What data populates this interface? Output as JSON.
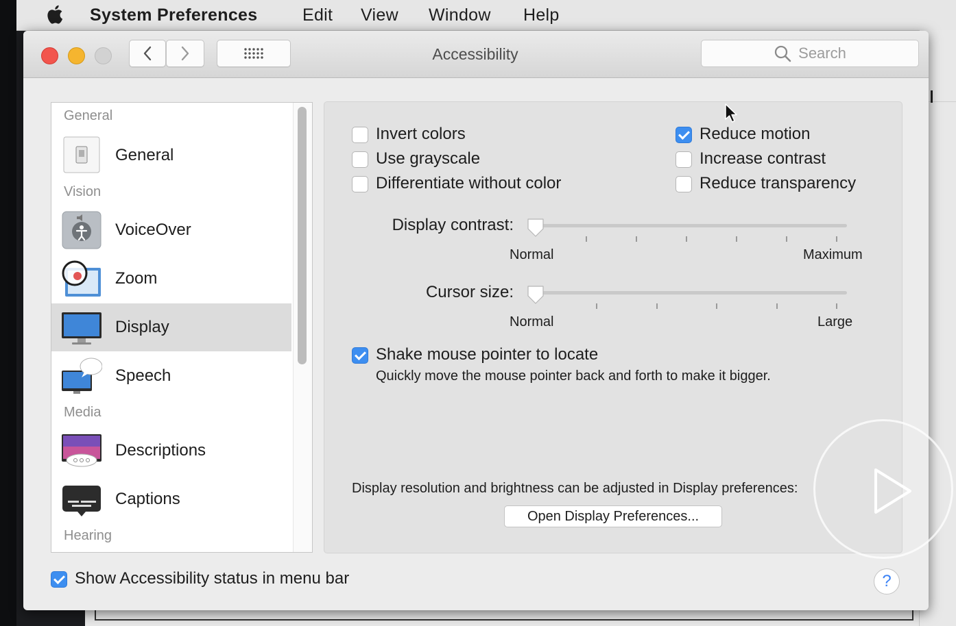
{
  "menubar": {
    "app_name": "System Preferences",
    "items": [
      "Edit",
      "View",
      "Window",
      "Help"
    ],
    "apple_icon": "apple-logo-icon"
  },
  "window": {
    "title": "Accessibility",
    "search_placeholder": "Search",
    "nav": {
      "back_icon": "chevron-left-icon",
      "forward_icon": "chevron-right-icon",
      "grid_icon": "grid-icon"
    }
  },
  "sidebar": {
    "sections": [
      "General",
      "Vision",
      "Media",
      "Hearing"
    ],
    "items": [
      {
        "label": "General",
        "icon": "switch-icon"
      },
      {
        "label": "VoiceOver",
        "icon": "voiceover-icon"
      },
      {
        "label": "Zoom",
        "icon": "zoom-icon"
      },
      {
        "label": "Display",
        "icon": "display-icon",
        "selected": true
      },
      {
        "label": "Speech",
        "icon": "speech-icon"
      },
      {
        "label": "Descriptions",
        "icon": "descriptions-icon"
      },
      {
        "label": "Captions",
        "icon": "captions-icon"
      }
    ]
  },
  "display": {
    "options": [
      {
        "label": "Invert colors",
        "checked": false
      },
      {
        "label": "Use grayscale",
        "checked": false
      },
      {
        "label": "Differentiate without color",
        "checked": false
      },
      {
        "label": "Reduce motion",
        "checked": true
      },
      {
        "label": "Increase contrast",
        "checked": false
      },
      {
        "label": "Reduce transparency",
        "checked": false
      }
    ],
    "contrast": {
      "label": "Display contrast:",
      "min_label": "Normal",
      "max_label": "Maximum",
      "value": 0
    },
    "cursor": {
      "label": "Cursor size:",
      "min_label": "Normal",
      "max_label": "Large",
      "value": 0
    },
    "shake": {
      "label": "Shake mouse pointer to locate",
      "checked": true,
      "description": "Quickly move the mouse pointer back and forth to make it bigger."
    },
    "note": "Display resolution and brightness can be adjusted in Display preferences:",
    "open_button": "Open Display Preferences..."
  },
  "footer": {
    "show_status_label": "Show Accessibility status in menu bar",
    "show_status_checked": true,
    "help_label": "?"
  },
  "accent_color": "#3d8ef0"
}
